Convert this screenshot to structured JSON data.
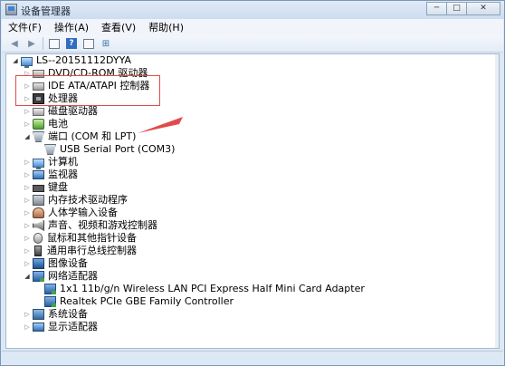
{
  "window": {
    "title": "设备管理器",
    "controls": [
      "─",
      "□",
      "✕"
    ]
  },
  "menu": [
    {
      "label": "文件(F)"
    },
    {
      "label": "操作(A)"
    },
    {
      "label": "查看(V)"
    },
    {
      "label": "帮助(H)"
    }
  ],
  "toolbar": {
    "buttons": [
      "back-arrow-icon",
      "forward-arrow-icon",
      "properties-icon",
      "help-icon",
      "view-icon",
      "scan-hardware-icon"
    ]
  },
  "tree": {
    "root": "LS--20151112DYYA",
    "items": [
      {
        "label": "DVD/CD-ROM 驱动器",
        "icon": "dvd-drive-icon"
      },
      {
        "label": "IDE ATA/ATAPI 控制器",
        "icon": "ide-controller-icon"
      },
      {
        "label": "处理器",
        "icon": "processor-icon"
      },
      {
        "label": "磁盘驱动器",
        "icon": "disk-drive-icon"
      },
      {
        "label": "电池",
        "icon": "battery-icon"
      },
      {
        "label": "端口 (COM 和 LPT)",
        "icon": "port-icon",
        "expanded": true
      },
      {
        "label": "USB Serial Port (COM3)",
        "icon": "port-icon",
        "child": true
      },
      {
        "label": "计算机",
        "icon": "computer-icon"
      },
      {
        "label": "监视器",
        "icon": "monitor-icon"
      },
      {
        "label": "键盘",
        "icon": "keyboard-icon"
      },
      {
        "label": "内存技术驱动程序",
        "icon": "memory-icon"
      },
      {
        "label": "人体学输入设备",
        "icon": "hid-icon"
      },
      {
        "label": "声音、视频和游戏控制器",
        "icon": "sound-icon"
      },
      {
        "label": "鼠标和其他指针设备",
        "icon": "mouse-icon"
      },
      {
        "label": "通用串行总线控制器",
        "icon": "usb-icon"
      },
      {
        "label": "图像设备",
        "icon": "imaging-icon"
      },
      {
        "label": "网络适配器",
        "icon": "network-icon",
        "expanded": true
      },
      {
        "label": "1x1 11b/g/n Wireless LAN PCI Express Half Mini Card Adapter",
        "icon": "network-adapter-icon",
        "child": true
      },
      {
        "label": "Realtek PCIe GBE Family Controller",
        "icon": "network-adapter-icon",
        "child": true
      },
      {
        "label": "系统设备",
        "icon": "system-icon"
      },
      {
        "label": "显示适配器",
        "icon": "display-adapter-icon"
      }
    ]
  },
  "colors": {
    "highlight_box": "#e24a4a",
    "callout_arrow": "#e24a4a",
    "window_frame": "#dbe8f6"
  }
}
